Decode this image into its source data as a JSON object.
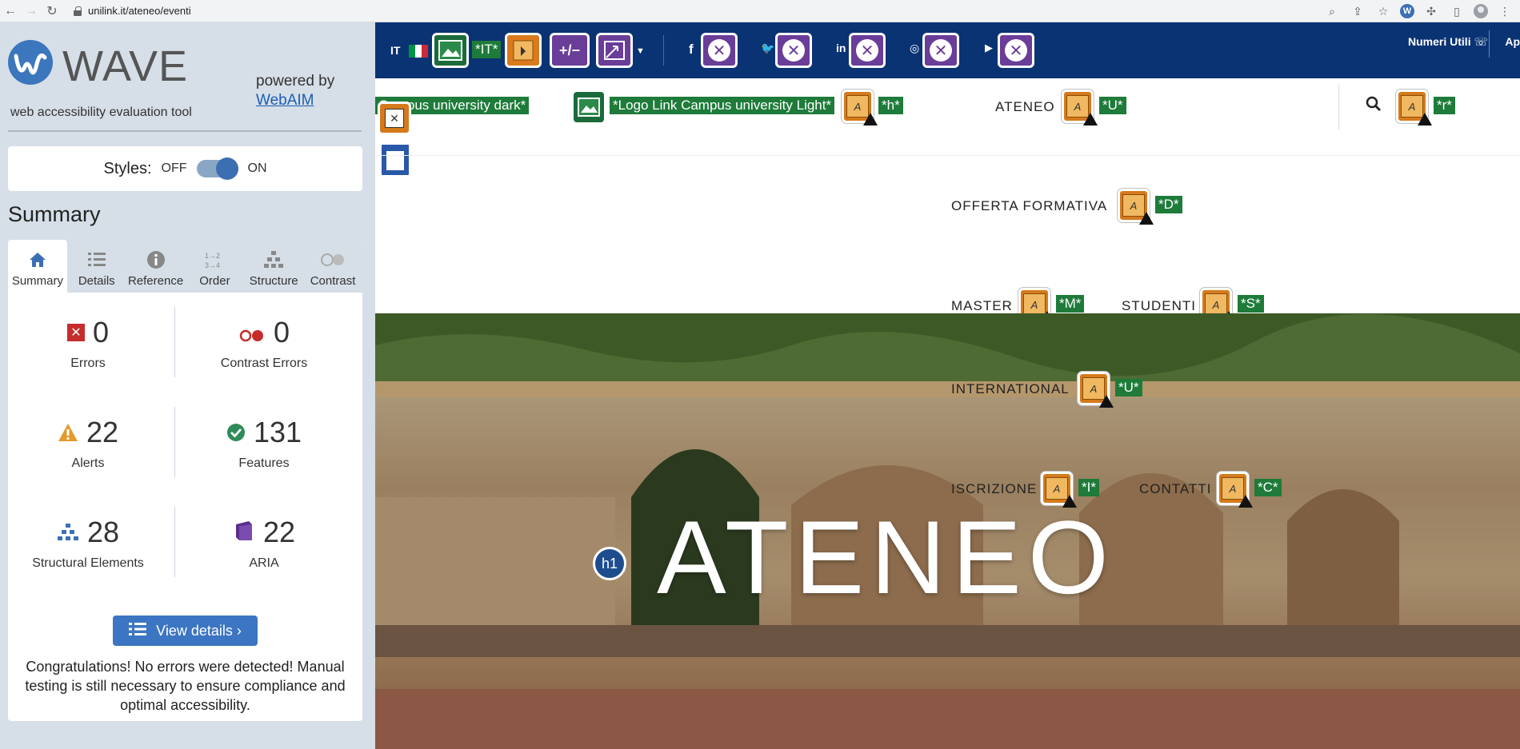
{
  "browser": {
    "url": "unilink.it/ateneo/eventi",
    "wave_ext_letter": "W"
  },
  "wave": {
    "title": "WAVE",
    "subtitle": "web accessibility evaluation tool",
    "powered_by": "powered by",
    "webaim": "WebAIM",
    "styles_label": "Styles:",
    "styles_off": "OFF",
    "styles_on": "ON",
    "summary_heading": "Summary",
    "tabs": [
      {
        "label": "Summary",
        "icon": "home-icon"
      },
      {
        "label": "Details",
        "icon": "list-icon"
      },
      {
        "label": "Reference",
        "icon": "info-icon"
      },
      {
        "label": "Order",
        "icon": "order-icon"
      },
      {
        "label": "Structure",
        "icon": "structure-icon"
      },
      {
        "label": "Contrast",
        "icon": "contrast-icon"
      }
    ],
    "stats": {
      "errors": {
        "value": "0",
        "label": "Errors"
      },
      "contrast_errors": {
        "value": "0",
        "label": "Contrast Errors"
      },
      "alerts": {
        "value": "22",
        "label": "Alerts"
      },
      "features": {
        "value": "131",
        "label": "Features"
      },
      "structural": {
        "value": "28",
        "label": "Structural Elements"
      },
      "aria": {
        "value": "22",
        "label": "ARIA"
      }
    },
    "view_details": "View details ›",
    "congrats": "Congratulations! No errors were detected! Manual testing is still necessary to ensure compliance and optimal accessibility."
  },
  "site": {
    "lang": "IT",
    "tag_it": "*IT*",
    "numeri_utili": "Numeri Utili",
    "ap": "Ap",
    "logo_dark_tag": "Campus university dark*",
    "logo_light_tag": "*Logo Link Campus university Light*",
    "tag_h": "*h*",
    "nav": {
      "ateneo": "ATENEO",
      "ateneo_tag": "*U*",
      "search_tag": "*r*",
      "offerta": "OFFERTA FORMATIVA",
      "offerta_tag": "*D*",
      "master": "MASTER",
      "master_tag": "*M*",
      "studenti": "STUDENTI",
      "studenti_tag": "*S*",
      "international": "INTERNATIONAL",
      "international_tag": "*U*",
      "iscrizione": "ISCRIZIONE",
      "iscrizione_tag": "*I*",
      "contatti": "CONTATTI",
      "contatti_tag": "*C*"
    },
    "hero_title": "ATENEO",
    "h1_badge": "h1",
    "toggle_label": "+/−",
    "social": {
      "facebook": "f",
      "twitter": "🐦",
      "linkedin": "in",
      "instagram": "◎",
      "youtube": "▶"
    },
    "alert_letter": "A",
    "close_x": "✕"
  },
  "colors": {
    "wave_blue": "#3c76bc",
    "site_navy": "#0a3373",
    "tag_green": "#1e7b3a",
    "alert_orange": "#d57a1c",
    "aria_purple": "#6a3d99"
  }
}
